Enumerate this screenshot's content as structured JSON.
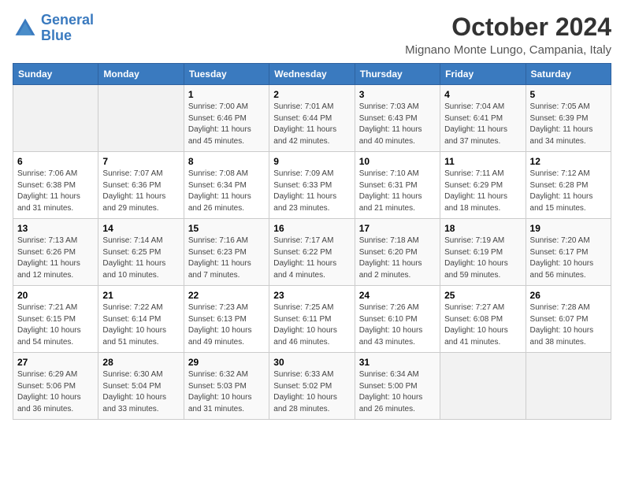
{
  "header": {
    "logo_line1": "General",
    "logo_line2": "Blue",
    "month_title": "October 2024",
    "location": "Mignano Monte Lungo, Campania, Italy"
  },
  "weekdays": [
    "Sunday",
    "Monday",
    "Tuesday",
    "Wednesday",
    "Thursday",
    "Friday",
    "Saturday"
  ],
  "weeks": [
    [
      {
        "day": "",
        "info": ""
      },
      {
        "day": "",
        "info": ""
      },
      {
        "day": "1",
        "info": "Sunrise: 7:00 AM\nSunset: 6:46 PM\nDaylight: 11 hours and 45 minutes."
      },
      {
        "day": "2",
        "info": "Sunrise: 7:01 AM\nSunset: 6:44 PM\nDaylight: 11 hours and 42 minutes."
      },
      {
        "day": "3",
        "info": "Sunrise: 7:03 AM\nSunset: 6:43 PM\nDaylight: 11 hours and 40 minutes."
      },
      {
        "day": "4",
        "info": "Sunrise: 7:04 AM\nSunset: 6:41 PM\nDaylight: 11 hours and 37 minutes."
      },
      {
        "day": "5",
        "info": "Sunrise: 7:05 AM\nSunset: 6:39 PM\nDaylight: 11 hours and 34 minutes."
      }
    ],
    [
      {
        "day": "6",
        "info": "Sunrise: 7:06 AM\nSunset: 6:38 PM\nDaylight: 11 hours and 31 minutes."
      },
      {
        "day": "7",
        "info": "Sunrise: 7:07 AM\nSunset: 6:36 PM\nDaylight: 11 hours and 29 minutes."
      },
      {
        "day": "8",
        "info": "Sunrise: 7:08 AM\nSunset: 6:34 PM\nDaylight: 11 hours and 26 minutes."
      },
      {
        "day": "9",
        "info": "Sunrise: 7:09 AM\nSunset: 6:33 PM\nDaylight: 11 hours and 23 minutes."
      },
      {
        "day": "10",
        "info": "Sunrise: 7:10 AM\nSunset: 6:31 PM\nDaylight: 11 hours and 21 minutes."
      },
      {
        "day": "11",
        "info": "Sunrise: 7:11 AM\nSunset: 6:29 PM\nDaylight: 11 hours and 18 minutes."
      },
      {
        "day": "12",
        "info": "Sunrise: 7:12 AM\nSunset: 6:28 PM\nDaylight: 11 hours and 15 minutes."
      }
    ],
    [
      {
        "day": "13",
        "info": "Sunrise: 7:13 AM\nSunset: 6:26 PM\nDaylight: 11 hours and 12 minutes."
      },
      {
        "day": "14",
        "info": "Sunrise: 7:14 AM\nSunset: 6:25 PM\nDaylight: 11 hours and 10 minutes."
      },
      {
        "day": "15",
        "info": "Sunrise: 7:16 AM\nSunset: 6:23 PM\nDaylight: 11 hours and 7 minutes."
      },
      {
        "day": "16",
        "info": "Sunrise: 7:17 AM\nSunset: 6:22 PM\nDaylight: 11 hours and 4 minutes."
      },
      {
        "day": "17",
        "info": "Sunrise: 7:18 AM\nSunset: 6:20 PM\nDaylight: 11 hours and 2 minutes."
      },
      {
        "day": "18",
        "info": "Sunrise: 7:19 AM\nSunset: 6:19 PM\nDaylight: 10 hours and 59 minutes."
      },
      {
        "day": "19",
        "info": "Sunrise: 7:20 AM\nSunset: 6:17 PM\nDaylight: 10 hours and 56 minutes."
      }
    ],
    [
      {
        "day": "20",
        "info": "Sunrise: 7:21 AM\nSunset: 6:15 PM\nDaylight: 10 hours and 54 minutes."
      },
      {
        "day": "21",
        "info": "Sunrise: 7:22 AM\nSunset: 6:14 PM\nDaylight: 10 hours and 51 minutes."
      },
      {
        "day": "22",
        "info": "Sunrise: 7:23 AM\nSunset: 6:13 PM\nDaylight: 10 hours and 49 minutes."
      },
      {
        "day": "23",
        "info": "Sunrise: 7:25 AM\nSunset: 6:11 PM\nDaylight: 10 hours and 46 minutes."
      },
      {
        "day": "24",
        "info": "Sunrise: 7:26 AM\nSunset: 6:10 PM\nDaylight: 10 hours and 43 minutes."
      },
      {
        "day": "25",
        "info": "Sunrise: 7:27 AM\nSunset: 6:08 PM\nDaylight: 10 hours and 41 minutes."
      },
      {
        "day": "26",
        "info": "Sunrise: 7:28 AM\nSunset: 6:07 PM\nDaylight: 10 hours and 38 minutes."
      }
    ],
    [
      {
        "day": "27",
        "info": "Sunrise: 6:29 AM\nSunset: 5:06 PM\nDaylight: 10 hours and 36 minutes."
      },
      {
        "day": "28",
        "info": "Sunrise: 6:30 AM\nSunset: 5:04 PM\nDaylight: 10 hours and 33 minutes."
      },
      {
        "day": "29",
        "info": "Sunrise: 6:32 AM\nSunset: 5:03 PM\nDaylight: 10 hours and 31 minutes."
      },
      {
        "day": "30",
        "info": "Sunrise: 6:33 AM\nSunset: 5:02 PM\nDaylight: 10 hours and 28 minutes."
      },
      {
        "day": "31",
        "info": "Sunrise: 6:34 AM\nSunset: 5:00 PM\nDaylight: 10 hours and 26 minutes."
      },
      {
        "day": "",
        "info": ""
      },
      {
        "day": "",
        "info": ""
      }
    ]
  ]
}
